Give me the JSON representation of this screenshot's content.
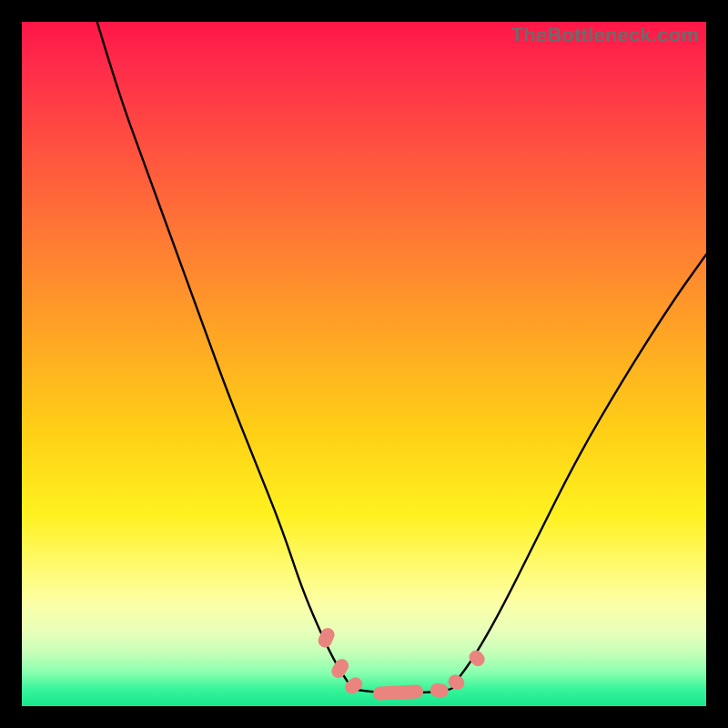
{
  "watermark": "TheBottleneck.com",
  "colors": {
    "frame_bg": "#000000",
    "curve_stroke": "#000000",
    "marker_fill": "#e9857e",
    "marker_stroke": "#e9857e"
  },
  "chart_data": {
    "type": "line",
    "title": "",
    "xlabel": "",
    "ylabel": "",
    "xlim": [
      0,
      100
    ],
    "ylim": [
      0,
      100
    ],
    "grid": false,
    "legend": false,
    "note": "Axes have no visible tick labels; values are normalized 0–100 estimates read from pixel positions. y increases upward (0 = bottom green band, 100 = top red band).",
    "series": [
      {
        "name": "left-branch",
        "x": [
          11,
          14,
          18,
          22,
          26,
          30,
          34,
          38,
          41,
          44,
          46,
          48
        ],
        "y": [
          100,
          90,
          79,
          68,
          57,
          46,
          36,
          26,
          17,
          10,
          6,
          3
        ]
      },
      {
        "name": "valley-floor",
        "x": [
          48,
          52,
          56,
          60,
          63
        ],
        "y": [
          2.5,
          2,
          2,
          2,
          2.5
        ]
      },
      {
        "name": "right-branch",
        "x": [
          63,
          66,
          70,
          75,
          81,
          88,
          95,
          100
        ],
        "y": [
          3,
          7,
          14,
          24,
          36,
          48,
          59,
          66
        ]
      }
    ],
    "markers": {
      "name": "highlighted-points",
      "shape": "rounded-capsule",
      "points_xy": [
        [
          44.5,
          10
        ],
        [
          46.5,
          5.5
        ],
        [
          48.5,
          3
        ],
        [
          55,
          2
        ],
        [
          61,
          2.3
        ],
        [
          63.5,
          3.5
        ],
        [
          66.5,
          7
        ]
      ]
    }
  }
}
